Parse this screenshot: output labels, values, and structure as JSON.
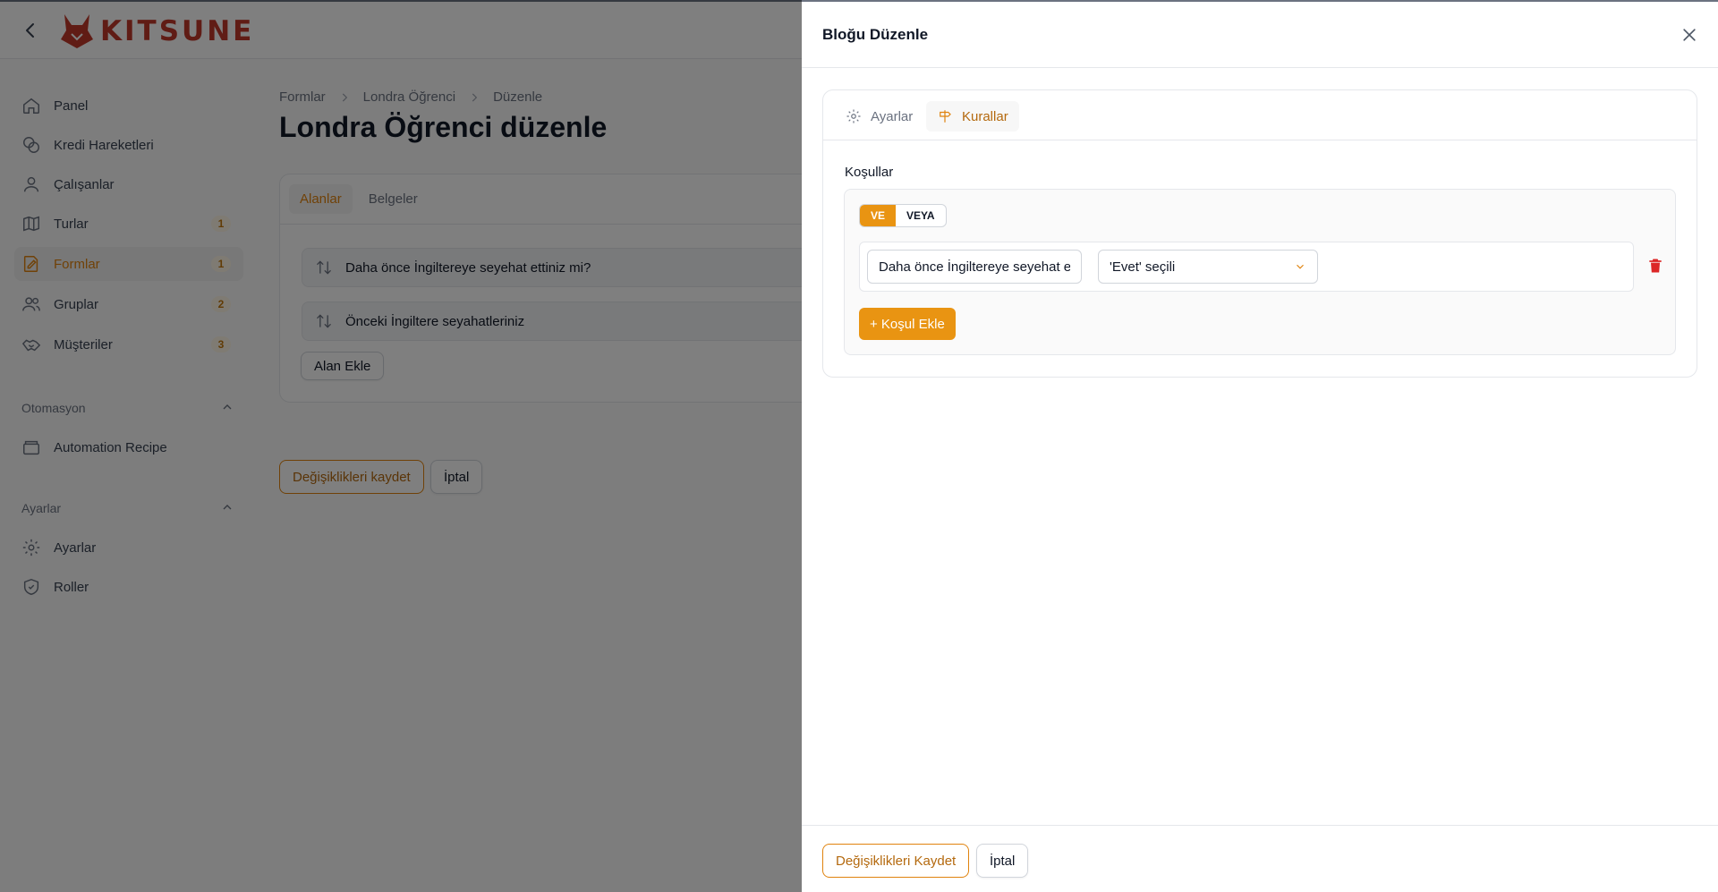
{
  "app": {
    "brand": "KITSUNE",
    "colors": {
      "accent": "#e0830e",
      "accent_fill": "#e99412",
      "danger": "#dc2626",
      "logo": "#c0392b"
    }
  },
  "sidebar": {
    "items": [
      {
        "label": "Panel",
        "icon": "home-icon",
        "badge": ""
      },
      {
        "label": "Kredi Hareketleri",
        "icon": "coins-icon",
        "badge": ""
      },
      {
        "label": "Çalışanlar",
        "icon": "user-icon",
        "badge": ""
      },
      {
        "label": "Turlar",
        "icon": "map-icon",
        "badge": "1"
      },
      {
        "label": "Formlar",
        "icon": "form-edit-icon",
        "badge": "1",
        "active": true
      },
      {
        "label": "Gruplar",
        "icon": "users-icon",
        "badge": "2"
      },
      {
        "label": "Müşteriler",
        "icon": "handshake-icon",
        "badge": "3"
      }
    ],
    "groups": [
      {
        "title": "Otomasyon",
        "items": [
          {
            "label": "Automation Recipe",
            "icon": "archive-icon"
          }
        ]
      },
      {
        "title": "Ayarlar",
        "items": [
          {
            "label": "Ayarlar",
            "icon": "gear-icon"
          },
          {
            "label": "Roller",
            "icon": "shield-icon"
          }
        ]
      }
    ]
  },
  "main": {
    "breadcrumb": [
      "Formlar",
      "Londra Öğrenci",
      "Düzenle"
    ],
    "title": "Londra Öğrenci düzenle",
    "tabs": [
      "Alanlar",
      "Belgeler"
    ],
    "fields": [
      "Daha önce İngiltereye seyehat ettiniz mi?",
      "Önceki İngiltere seyahatleriniz"
    ],
    "add_field": "Alan Ekle",
    "save": "Değişiklikleri kaydet",
    "cancel": "İptal"
  },
  "drawer": {
    "title": "Bloğu Düzenle",
    "tabs": [
      {
        "label": "Ayarlar",
        "icon": "gear-icon"
      },
      {
        "label": "Kurallar",
        "icon": "signpost-icon",
        "active": true
      }
    ],
    "conditions_title": "Koşullar",
    "logic": {
      "and": "VE",
      "or": "VEYA",
      "selected": "VE"
    },
    "condition": {
      "field": "Daha önce İngiltereye seyehat ettiniz mi?",
      "operator": "'Evet' seçili"
    },
    "add_condition": "+ Koşul Ekle",
    "footer": {
      "save": "Değişiklikleri Kaydet",
      "cancel": "İptal"
    }
  }
}
